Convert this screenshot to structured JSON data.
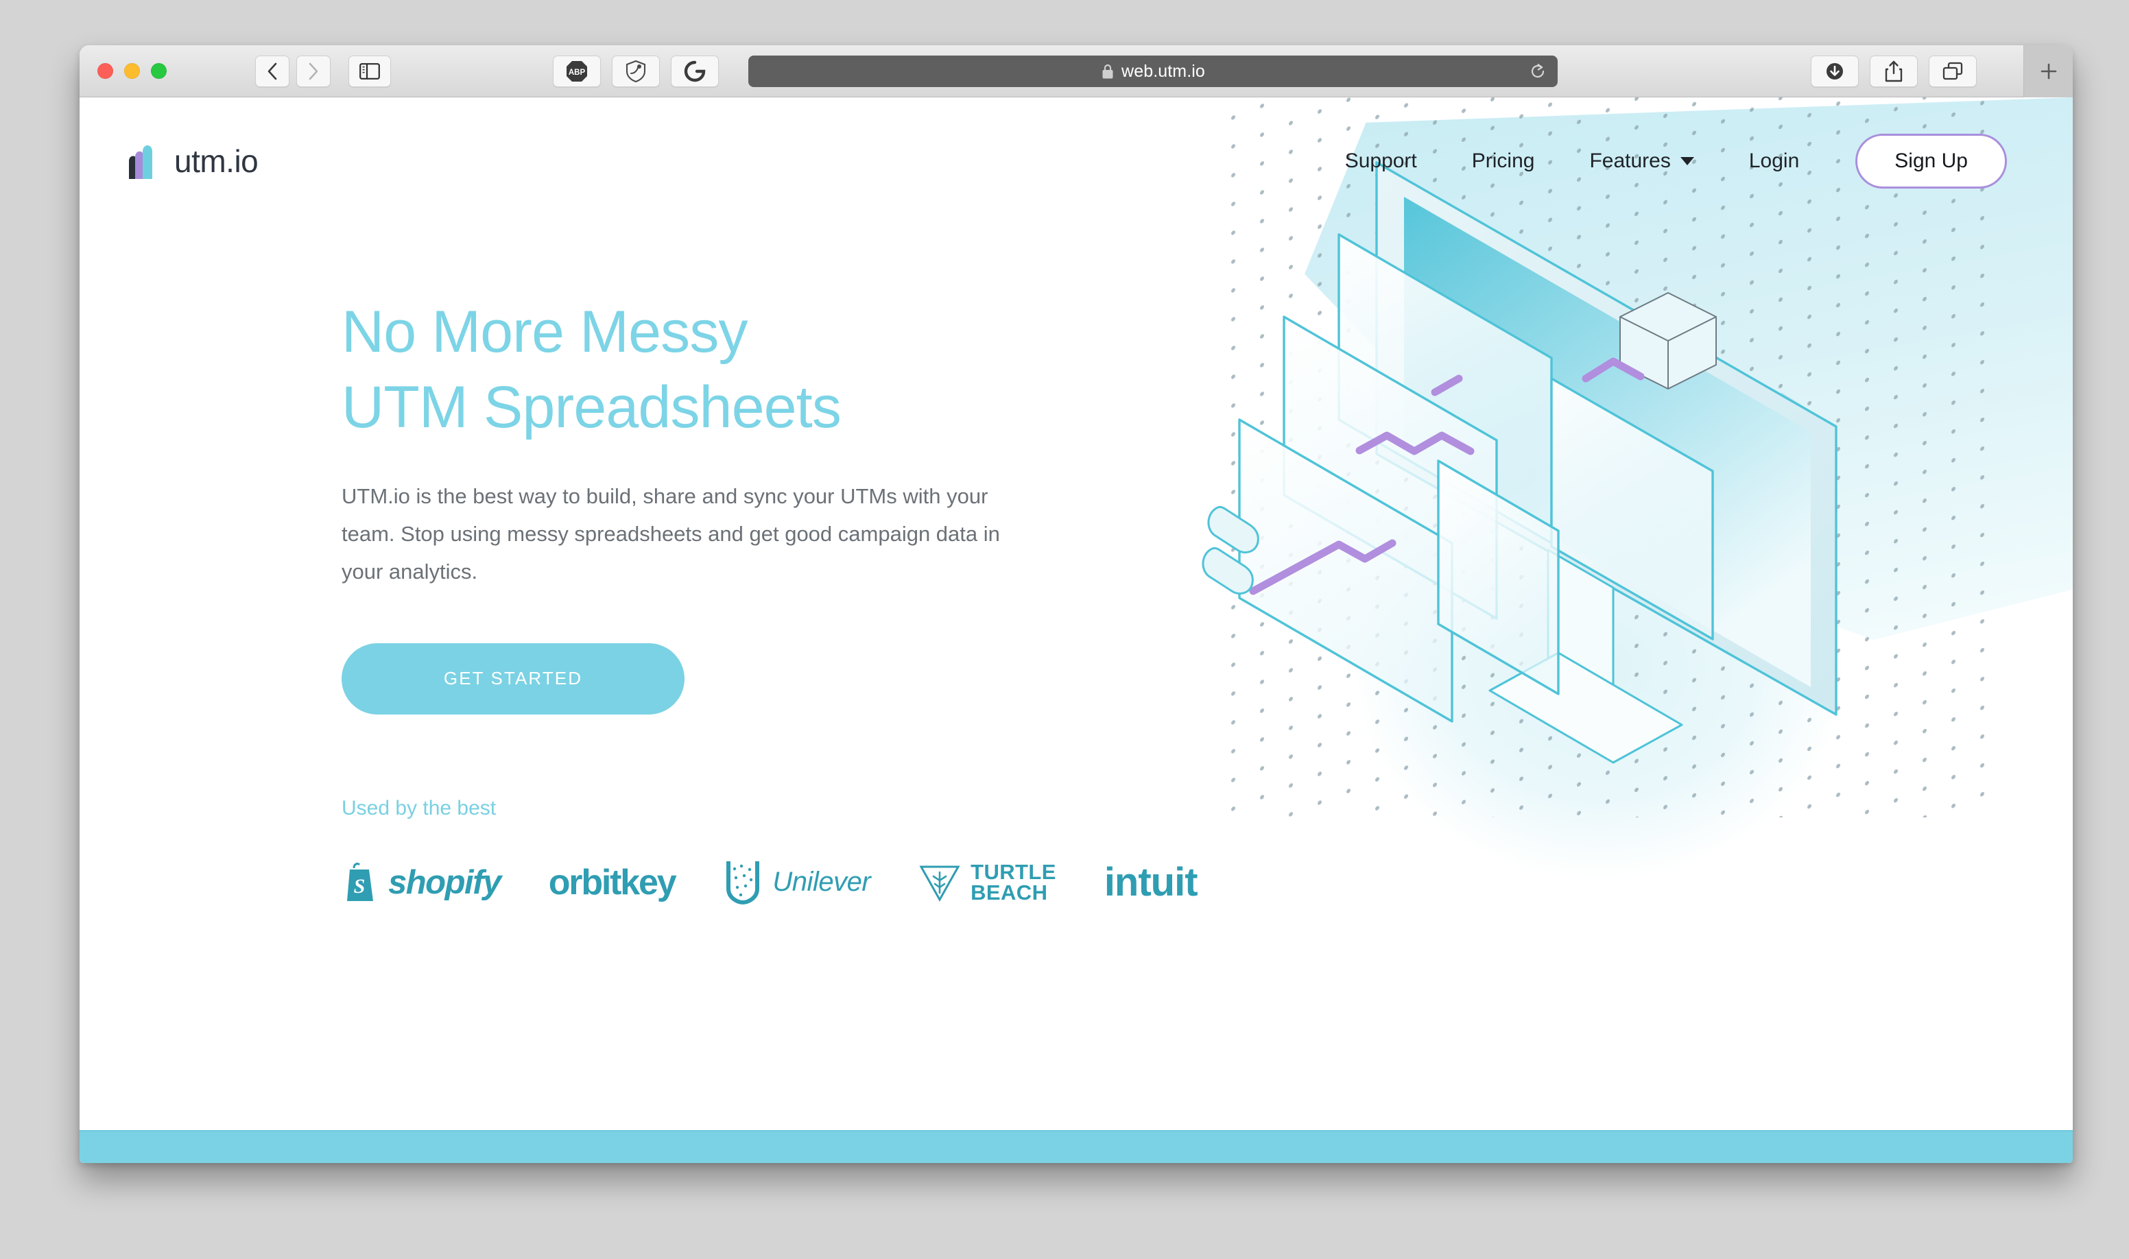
{
  "browser": {
    "url": "web.utm.io",
    "lock_icon": "lock-icon",
    "reload_icon": "reload-icon",
    "back_icon": "chevron-left-icon",
    "forward_icon": "chevron-right-icon",
    "sidebar_icon": "sidebar-toggle-icon",
    "extensions": [
      {
        "name": "adblock-plus-icon",
        "label": "ABP"
      },
      {
        "name": "shield-privacy-icon",
        "label": ""
      },
      {
        "name": "grammarly-icon",
        "label": "G"
      }
    ],
    "right_buttons": [
      {
        "name": "downloads-icon"
      },
      {
        "name": "share-icon"
      },
      {
        "name": "tab-overview-icon"
      }
    ],
    "new_tab_label": "+"
  },
  "site": {
    "logo": {
      "wordmark": "utm.io",
      "mark_colors": [
        "#2a2f3a",
        "#a78bda",
        "#6ecfdf"
      ]
    },
    "nav": [
      {
        "label": "Support",
        "has_caret": false
      },
      {
        "label": "Pricing",
        "has_caret": false
      },
      {
        "label": "Features",
        "has_caret": true
      },
      {
        "label": "Login",
        "has_caret": false
      }
    ],
    "signup_label": "Sign Up"
  },
  "hero": {
    "headline_line1": "No More Messy",
    "headline_line2": "UTM Spreadsheets",
    "subcopy": "UTM.io is the best way to build, share and sync your UTMs with your team. Stop using messy spreadsheets and get good campaign data in your analytics.",
    "cta_label": "GET STARTED",
    "used_by_label": "Used by the best",
    "clients": [
      {
        "name": "shopify",
        "label": "shopify"
      },
      {
        "name": "orbitkey",
        "label": "orbitkey"
      },
      {
        "name": "unilever",
        "label": "Unilever"
      },
      {
        "name": "turtle-beach",
        "label_line1": "TURTLE",
        "label_line2": "BEACH"
      },
      {
        "name": "intuit",
        "label": "intuit"
      }
    ]
  },
  "colors": {
    "accent_teal": "#7bd2e4",
    "headline_teal": "#7cd4e6",
    "logo_teal": "#2f9db2",
    "purple": "#a98fdc",
    "body_gray": "#6b7177",
    "bottom_bar": "#7bd2e4"
  }
}
